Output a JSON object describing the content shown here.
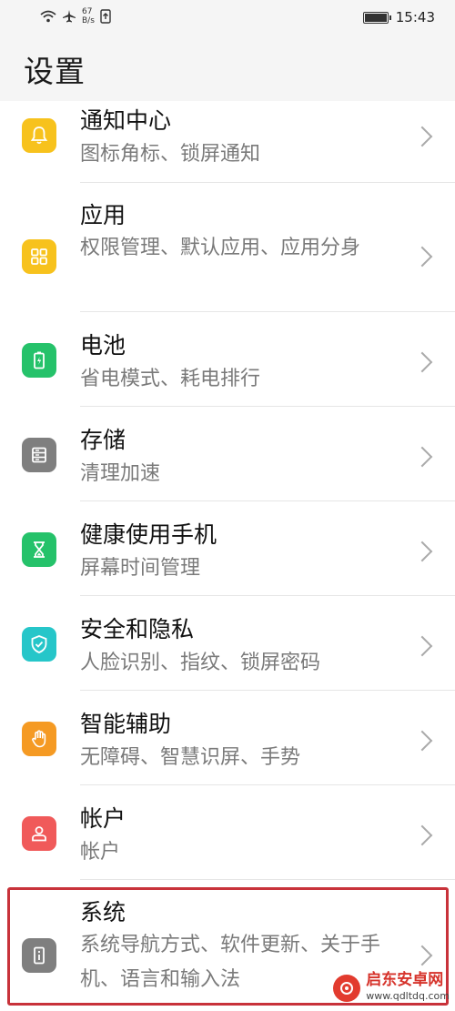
{
  "status_bar": {
    "speed_value": "67",
    "speed_unit": "B/s",
    "time": "15:43"
  },
  "header": {
    "title": "设置"
  },
  "items": [
    {
      "title": "通知中心",
      "subtitle": "图标角标、锁屏通知",
      "icon": "bell-icon",
      "color": "#f7c21d"
    },
    {
      "title": "应用",
      "subtitle": "权限管理、默认应用、应用分身",
      "icon": "apps-grid-icon",
      "color": "#f7c21d"
    },
    {
      "title": "电池",
      "subtitle": "省电模式、耗电排行",
      "icon": "battery-icon",
      "color": "#25c26a"
    },
    {
      "title": "存储",
      "subtitle": "清理加速",
      "icon": "storage-icon",
      "color": "#7f7f7f"
    },
    {
      "title": "健康使用手机",
      "subtitle": "屏幕时间管理",
      "icon": "hourglass-icon",
      "color": "#25c26a"
    },
    {
      "title": "安全和隐私",
      "subtitle": "人脸识别、指纹、锁屏密码",
      "icon": "shield-check-icon",
      "color": "#26c6c9"
    },
    {
      "title": "智能辅助",
      "subtitle": "无障碍、智慧识屏、手势",
      "icon": "hand-icon",
      "color": "#f59a23"
    },
    {
      "title": "帐户",
      "subtitle": "帐户",
      "icon": "person-icon",
      "color": "#f05a5a"
    },
    {
      "title": "系统",
      "subtitle": "系统导航方式、软件更新、关于手机、语言和输入法",
      "icon": "info-phone-icon",
      "color": "#7f7f7f"
    }
  ],
  "watermark": {
    "name": "启东安卓网",
    "url": "www.qdltdq.com"
  }
}
